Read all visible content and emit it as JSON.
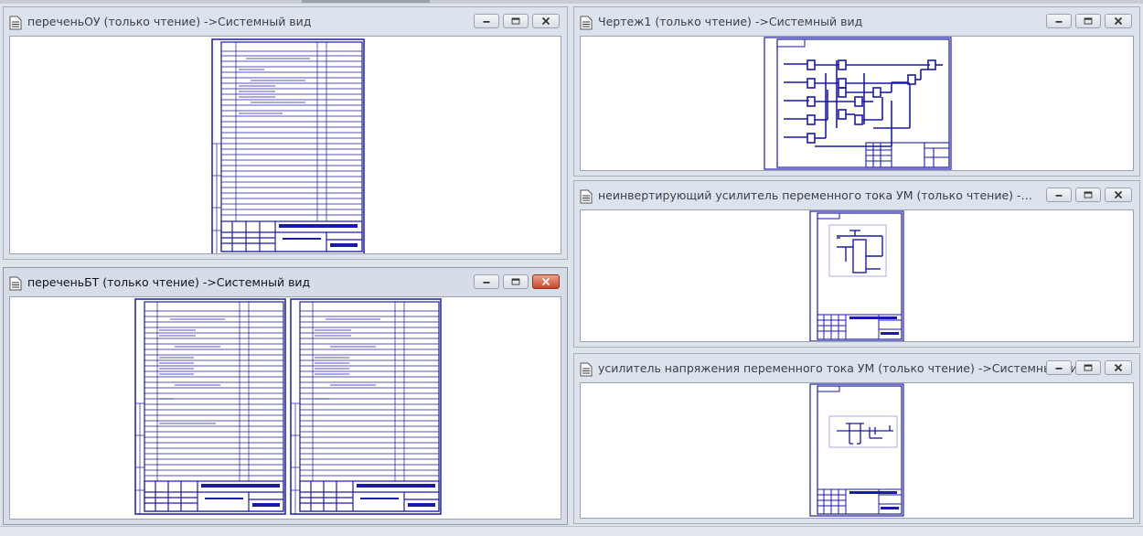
{
  "windows": {
    "w1": {
      "title": "переченьОУ (только чтение) ->Системный вид"
    },
    "w2": {
      "title": "переченьБТ (только чтение) ->Системный вид"
    },
    "w3": {
      "title": "Чертеж1 (только чтение) ->Системный вид"
    },
    "w4": {
      "title": "неинвертирующий усилитель переменного тока УМ (только чтение) ->Системный в..."
    },
    "w5": {
      "title": "усилитель напряжения переменного тока УМ (только чтение) ->Системный вид"
    }
  },
  "icons": {
    "document": "document-icon",
    "minimize": "minimize-icon",
    "maximize": "maximize-icon",
    "close": "close-icon"
  },
  "colors": {
    "drawing_line": "#1a1aa8",
    "close_active": "#c9452a"
  },
  "active_window": "w2"
}
